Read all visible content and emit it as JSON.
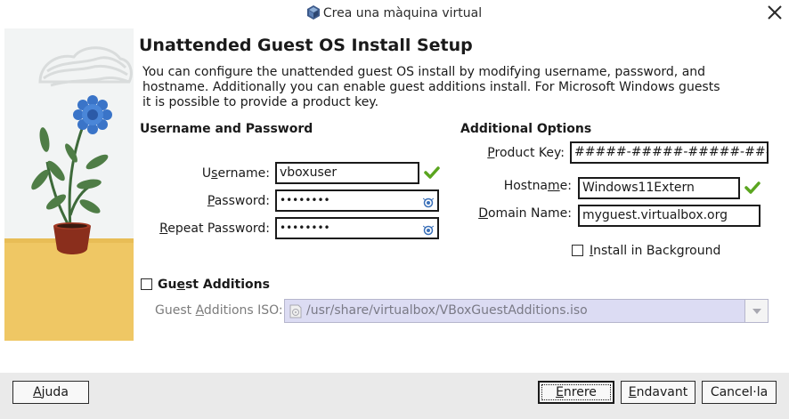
{
  "window": {
    "title": "Crea una màquina virtual",
    "app_icon": "virtualbox-icon",
    "close_icon": "close-icon"
  },
  "page": {
    "title": "Unattended Guest OS Install Setup",
    "description": "You can configure the unattended guest OS install by modifying username, password, and hostname. Additionally you can enable guest additions install. For Microsoft Windows guests it is possible to provide a product key."
  },
  "credentials": {
    "heading": "Username and Password",
    "username_label_pre": "U",
    "username_label_ul": "s",
    "username_label_post": "ername:",
    "username_value": "vboxuser",
    "password_label_pre": "",
    "password_label_ul": "P",
    "password_label_post": "assword:",
    "password_value": "••••••••",
    "repeat_label_pre": "",
    "repeat_label_ul": "R",
    "repeat_label_post": "epeat Password:",
    "repeat_value": "••••••••"
  },
  "options": {
    "heading": "Additional Options",
    "product_key_label_pre": "",
    "product_key_label_ul": "P",
    "product_key_label_post": "roduct Key:",
    "product_key_value": "#####-#####-#####-#####-",
    "hostname_label_pre": "Hostna",
    "hostname_label_ul": "m",
    "hostname_label_post": "e:",
    "hostname_value": "Windows11Extern",
    "domain_label_pre": "",
    "domain_label_ul": "D",
    "domain_label_post": "omain Name:",
    "domain_value": "myguest.virtualbox.org",
    "install_bg_label_pre": "",
    "install_bg_label_ul": "I",
    "install_bg_label_post": "nstall in Background",
    "install_bg_checked": false
  },
  "guest_additions": {
    "label_pre": "Gu",
    "label_ul": "e",
    "label_post": "st Additions",
    "checked": false,
    "iso_label_pre": "Guest ",
    "iso_label_ul": "A",
    "iso_label_post": "dditions ISO:",
    "iso_path": "/usr/share/virtualbox/VBoxGuestAdditions.iso"
  },
  "footer": {
    "help_pre": "",
    "help_ul": "A",
    "help_post": "juda",
    "back_pre": "",
    "back_ul": "E",
    "back_post": "nrere",
    "next_pre": "",
    "next_ul": "E",
    "next_post": "ndavant",
    "cancel_label": "Cancel·la"
  },
  "colors": {
    "check_green": "#5aa51f",
    "iso_field_bg": "#dcdcf3",
    "footer_bg": "#eaeaea"
  }
}
